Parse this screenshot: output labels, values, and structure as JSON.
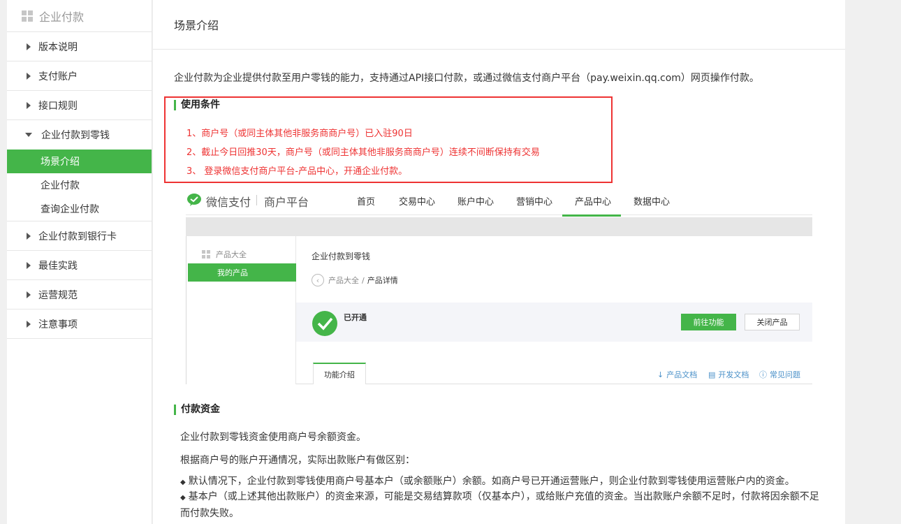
{
  "sidebar": {
    "header": "企业付款",
    "items": [
      {
        "label": "版本说明"
      },
      {
        "label": "支付账户"
      },
      {
        "label": "接口规则"
      }
    ],
    "expanded": {
      "label": "企业付款到零钱",
      "subs": [
        {
          "label": "场景介绍",
          "active": true
        },
        {
          "label": "企业付款"
        },
        {
          "label": "查询企业付款"
        }
      ]
    },
    "items_after": [
      {
        "label": "企业付款到银行卡"
      },
      {
        "label": "最佳实践"
      },
      {
        "label": "运营规范"
      },
      {
        "label": "注意事项"
      }
    ]
  },
  "main": {
    "title": "场景介绍",
    "intro": "企业付款为企业提供付款至用户零钱的能力，支持通过API接口付款，或通过微信支付商户平台（pay.weixin.qq.com）网页操作付款。",
    "conditions": {
      "heading": "使用条件",
      "items": [
        "1、商户号（或同主体其他非服务商商户号）已入驻90日",
        "2、截止今日回推30天，商户号（或同主体其他非服务商商户号）连续不间断保持有交易",
        "3、 登录微信支付商户平台-产品中心，开通企业付款。"
      ]
    },
    "screenshot": {
      "brand": "微信支付",
      "merchant": "商户平台",
      "nav": [
        "首页",
        "交易中心",
        "账户中心",
        "营销中心",
        "产品中心",
        "数据中心"
      ],
      "nav_active": "产品中心",
      "side_all": "产品大全",
      "side_mine": "我的产品",
      "product_title": "企业付款到零钱",
      "crumb_parent": "产品大全",
      "crumb_sep": "/",
      "crumb_current": "产品详情",
      "status": "已开通",
      "go_button": "前往功能",
      "close_button": "关闭产品",
      "tab": "功能介绍",
      "links": [
        "产品文档",
        "开发文档",
        "常见问题"
      ]
    },
    "funds": {
      "heading": "付款资金",
      "p1": "企业付款到零钱资金使用商户号余额资金。",
      "p2": "根据商户号的账户开通情况，实际出款账户有做区别：",
      "b1": "默认情况下，企业付款到零钱使用商户号基本户（或余额账户）余额。如商户号已开通运营账户，则企业付款到零钱使用运营账户内的资金。",
      "b2": "基本户（或上述其他出款账户）的资金来源，可能是交易结算款项（仅基本户），或给账户充值的资金。当出款账户余额不足时，付款将因余额不足而付款失败。"
    }
  },
  "colors": {
    "accent": "#44b549",
    "highlight_red": "#e33"
  }
}
